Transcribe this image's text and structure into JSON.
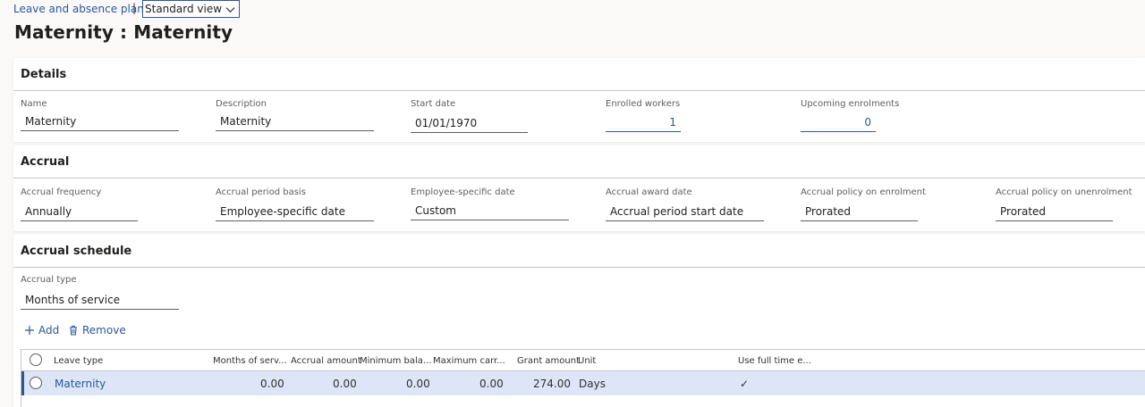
{
  "header": {
    "breadcrumb": "Leave and absence plans",
    "separator": "|",
    "view_selector": "Standard view",
    "title": "Maternity : Maternity"
  },
  "details": {
    "heading": "Details",
    "fields": [
      {
        "label": "Name",
        "value": "Maternity"
      },
      {
        "label": "Description",
        "value": "Maternity"
      },
      {
        "label": "Start date",
        "value": "01/01/1970"
      },
      {
        "label": "Enrolled workers",
        "value": "1"
      },
      {
        "label": "Upcoming enrolments",
        "value": "0"
      }
    ]
  },
  "accrual": {
    "heading": "Accrual",
    "fields": [
      {
        "label": "Accrual frequency",
        "value": "Annually"
      },
      {
        "label": "Accrual period basis",
        "value": "Employee-specific date"
      },
      {
        "label": "Employee-specific date",
        "value": "Custom"
      },
      {
        "label": "Accrual award date",
        "value": "Accrual period start date"
      },
      {
        "label": "Accrual policy on enrolment",
        "value": "Prorated"
      },
      {
        "label": "Accrual policy on unenrolment",
        "value": "Prorated"
      }
    ]
  },
  "schedule": {
    "heading": "Accrual schedule",
    "accrual_type_label": "Accrual type",
    "accrual_type_value": "Months of service",
    "add_label": "Add",
    "remove_label": "Remove",
    "columns": [
      "Leave type",
      "Months of serv...",
      "Accrual amount",
      "Minimum bala...",
      "Maximum carr...",
      "Grant amount",
      "Unit",
      "Use full time e..."
    ],
    "rows": [
      {
        "leave_type": "Maternity",
        "months": "0.00",
        "accrual": "0.00",
        "minimum": "0.00",
        "maximum": "0.00",
        "grant": "274.00",
        "unit": "Days",
        "full_time": "✓"
      }
    ]
  },
  "colors": {
    "accent": "#2b579a",
    "selected_row": "#dce6f7"
  }
}
